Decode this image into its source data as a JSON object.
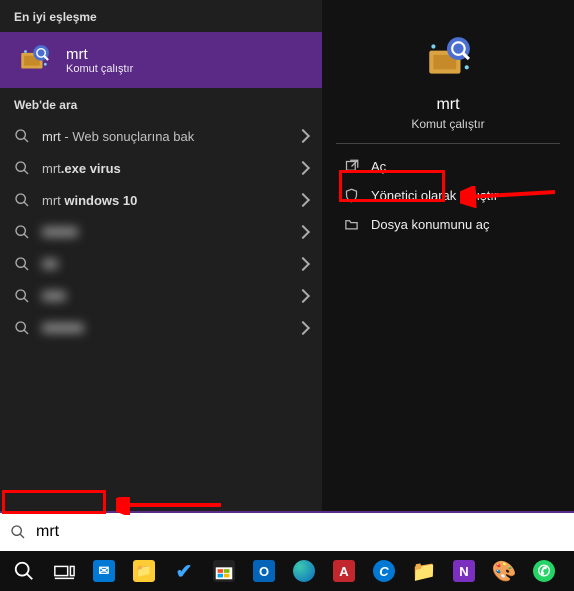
{
  "left": {
    "bestMatchHeader": "En iyi eşleşme",
    "bestMatch": {
      "title": "mrt",
      "subtitle": "Komut çalıştır"
    },
    "webHeader": "Web'de ara",
    "items": [
      {
        "prefix": "mrt",
        "suffix": " - Web sonuçlarına bak",
        "blur": false
      },
      {
        "prefix": "mrt",
        "bold": ".exe virus",
        "blur": false
      },
      {
        "prefix": "mrt ",
        "bold": "windows 10",
        "blur": false
      },
      {
        "blur": true
      },
      {
        "blur": true
      },
      {
        "blur": true
      },
      {
        "blur": true
      }
    ]
  },
  "right": {
    "title": "mrt",
    "subtitle": "Komut çalıştır",
    "actions": [
      {
        "icon": "open",
        "label": "Aç"
      },
      {
        "icon": "admin",
        "label": "Yönetici olarak çalıştır"
      },
      {
        "icon": "folder",
        "label": "Dosya konumunu aç"
      }
    ]
  },
  "search": {
    "value": "mrt"
  },
  "colors": {
    "accent": "#5b2a86",
    "highlight": "#f00"
  }
}
